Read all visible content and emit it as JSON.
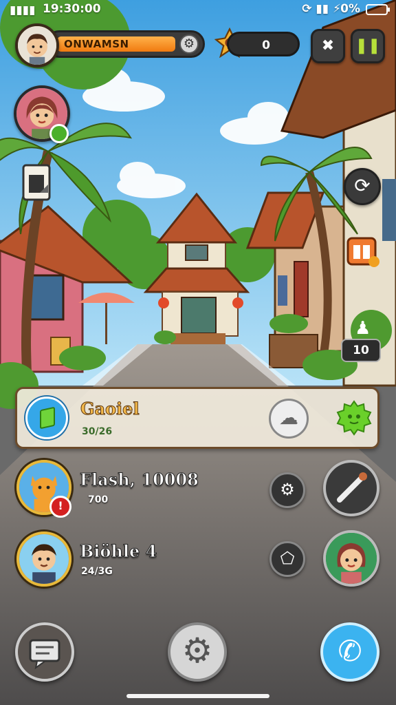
{
  "status_bar": {
    "time": "19:30:00",
    "signal": "▮▮▮▮",
    "icons": "⟳ ▮▮ ⚡",
    "battery": "0%"
  },
  "player": {
    "name": "ONWAMSN",
    "gear_glyph": "⚙"
  },
  "currency": {
    "value": "0"
  },
  "top_buttons": {
    "tools_glyph": "✖",
    "pause_glyph": "❚❚"
  },
  "side": {
    "refresh_glyph": "⟳",
    "count_badge": "10",
    "pawn_glyph": "♟"
  },
  "panel": {
    "title": "Gaoiel",
    "subtitle": "30/26",
    "button1_glyph": "☁"
  },
  "rows": [
    {
      "title": "Flash, 10008",
      "subtitle": "700",
      "alert_glyph": "!",
      "action_glyph": "⚙"
    },
    {
      "title": "Biöhle 4",
      "subtitle": "24/3G",
      "action_glyph": "⬠"
    }
  ],
  "bottom_bar": {
    "settings_glyph": "⚙",
    "phone_glyph": "✆"
  },
  "colors": {
    "accent_orange": "#f07a10",
    "accent_green": "#6fd43a",
    "accent_blue": "#35a7e8",
    "panel_bg": "#f0eadc"
  }
}
